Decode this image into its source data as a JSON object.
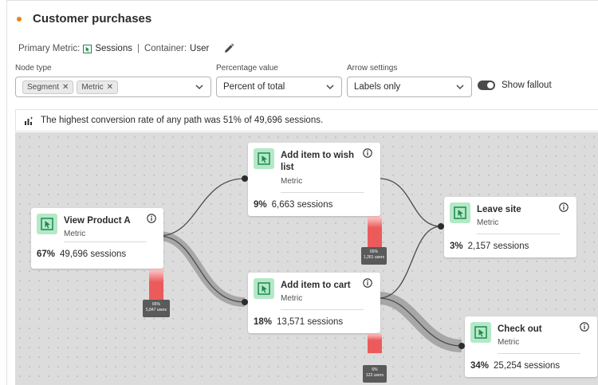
{
  "panel": {
    "title": "Customer purchases",
    "primary_metric_label": "Primary Metric:",
    "primary_metric_value": "Sessions",
    "separator": "|",
    "container_label": "Container:",
    "container_value": "User"
  },
  "filters": {
    "node_type_label": "Node type",
    "node_type_tags": [
      "Segment",
      "Metric"
    ],
    "percentage_label": "Percentage value",
    "percentage_value": "Percent of total",
    "arrow_label": "Arrow settings",
    "arrow_value": "Labels only",
    "show_fallout_label": "Show fallout",
    "show_fallout_on": true
  },
  "info_message": "The highest conversion rate of any path was 51% of 49,696 sessions.",
  "nodes": [
    {
      "name": "View Product A",
      "type": "Metric",
      "percent": "67%",
      "sessions": "49,696 sessions"
    },
    {
      "name_line1": "Add item to wish",
      "name_line2": "list",
      "type": "Metric",
      "percent": "9%",
      "sessions": "6,663 sessions"
    },
    {
      "name": "Add item to cart",
      "type": "Metric",
      "percent": "18%",
      "sessions": "13,571 sessions"
    },
    {
      "name": "Leave site",
      "type": "Metric",
      "percent": "3%",
      "sessions": "2,157 sessions"
    },
    {
      "name": "Check out",
      "type": "Metric",
      "percent": "34%",
      "sessions": "25,254 sessions"
    }
  ],
  "fallouts": [
    {
      "percent": "65%",
      "users": "5,847 users",
      "fill": 0.65
    },
    {
      "percent": "65%",
      "users": "1,261 users",
      "fill": 0.65
    },
    {
      "percent": "6%",
      "users": "122 users",
      "fill": 0.06
    }
  ],
  "colors": {
    "accent_orange": "#e68619",
    "node_icon_bg": "#b5e8c8",
    "node_icon_fg": "#1d8a4c",
    "fallout_red": "#ec5b5b",
    "canvas_bg": "#dcdcdc"
  }
}
